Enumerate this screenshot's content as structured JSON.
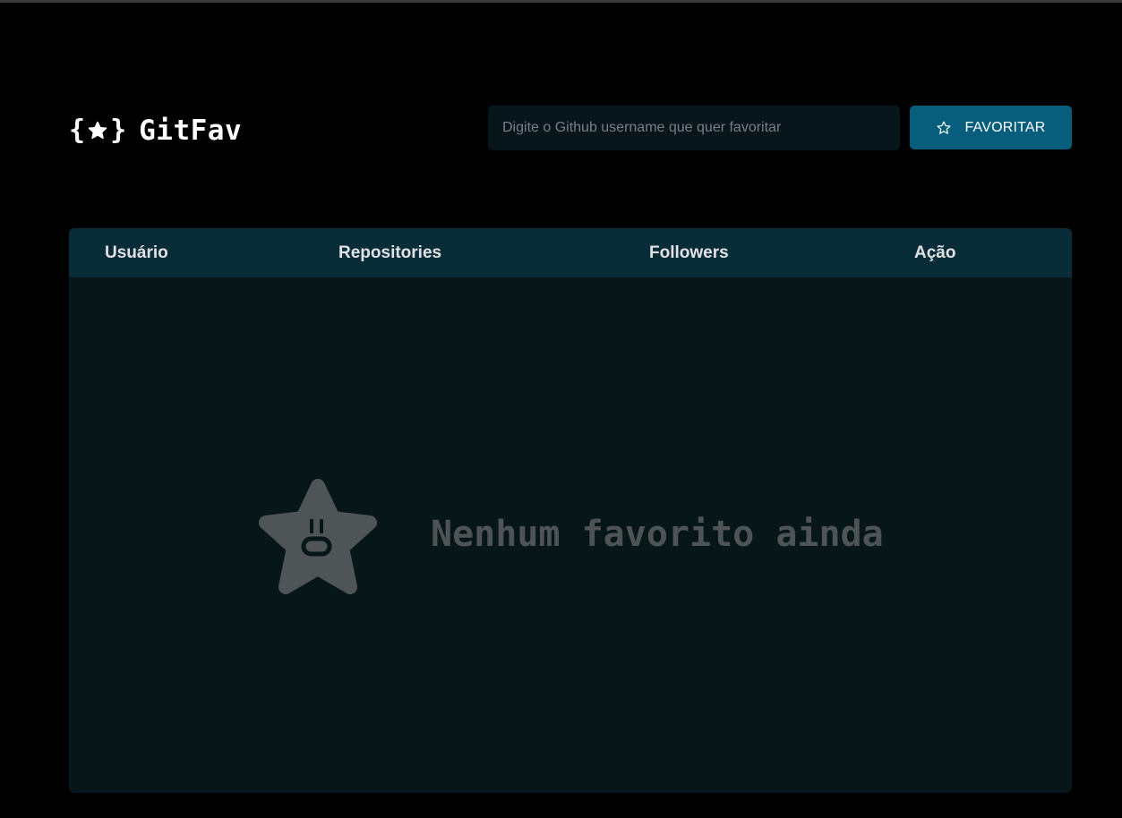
{
  "app": {
    "logo_left_brace": "{",
    "logo_right_brace": "}",
    "title": "GitFav"
  },
  "search": {
    "placeholder": "Digite o Github username que quer favoritar",
    "value": ""
  },
  "favorite_button": {
    "label": "FAVORITAR",
    "icon": "star-outline-icon"
  },
  "table": {
    "columns": [
      "Usuário",
      "Repositories",
      "Followers",
      "Ação"
    ],
    "rows": []
  },
  "empty_state": {
    "message": "Nenhum favorito ainda",
    "icon": "sad-star-icon"
  },
  "colors": {
    "background": "#000000",
    "accent": "#065e7c",
    "table_header": "#092d38",
    "table_body": "#061619",
    "input_background": "#06161b",
    "empty_text": "#4e5455"
  }
}
